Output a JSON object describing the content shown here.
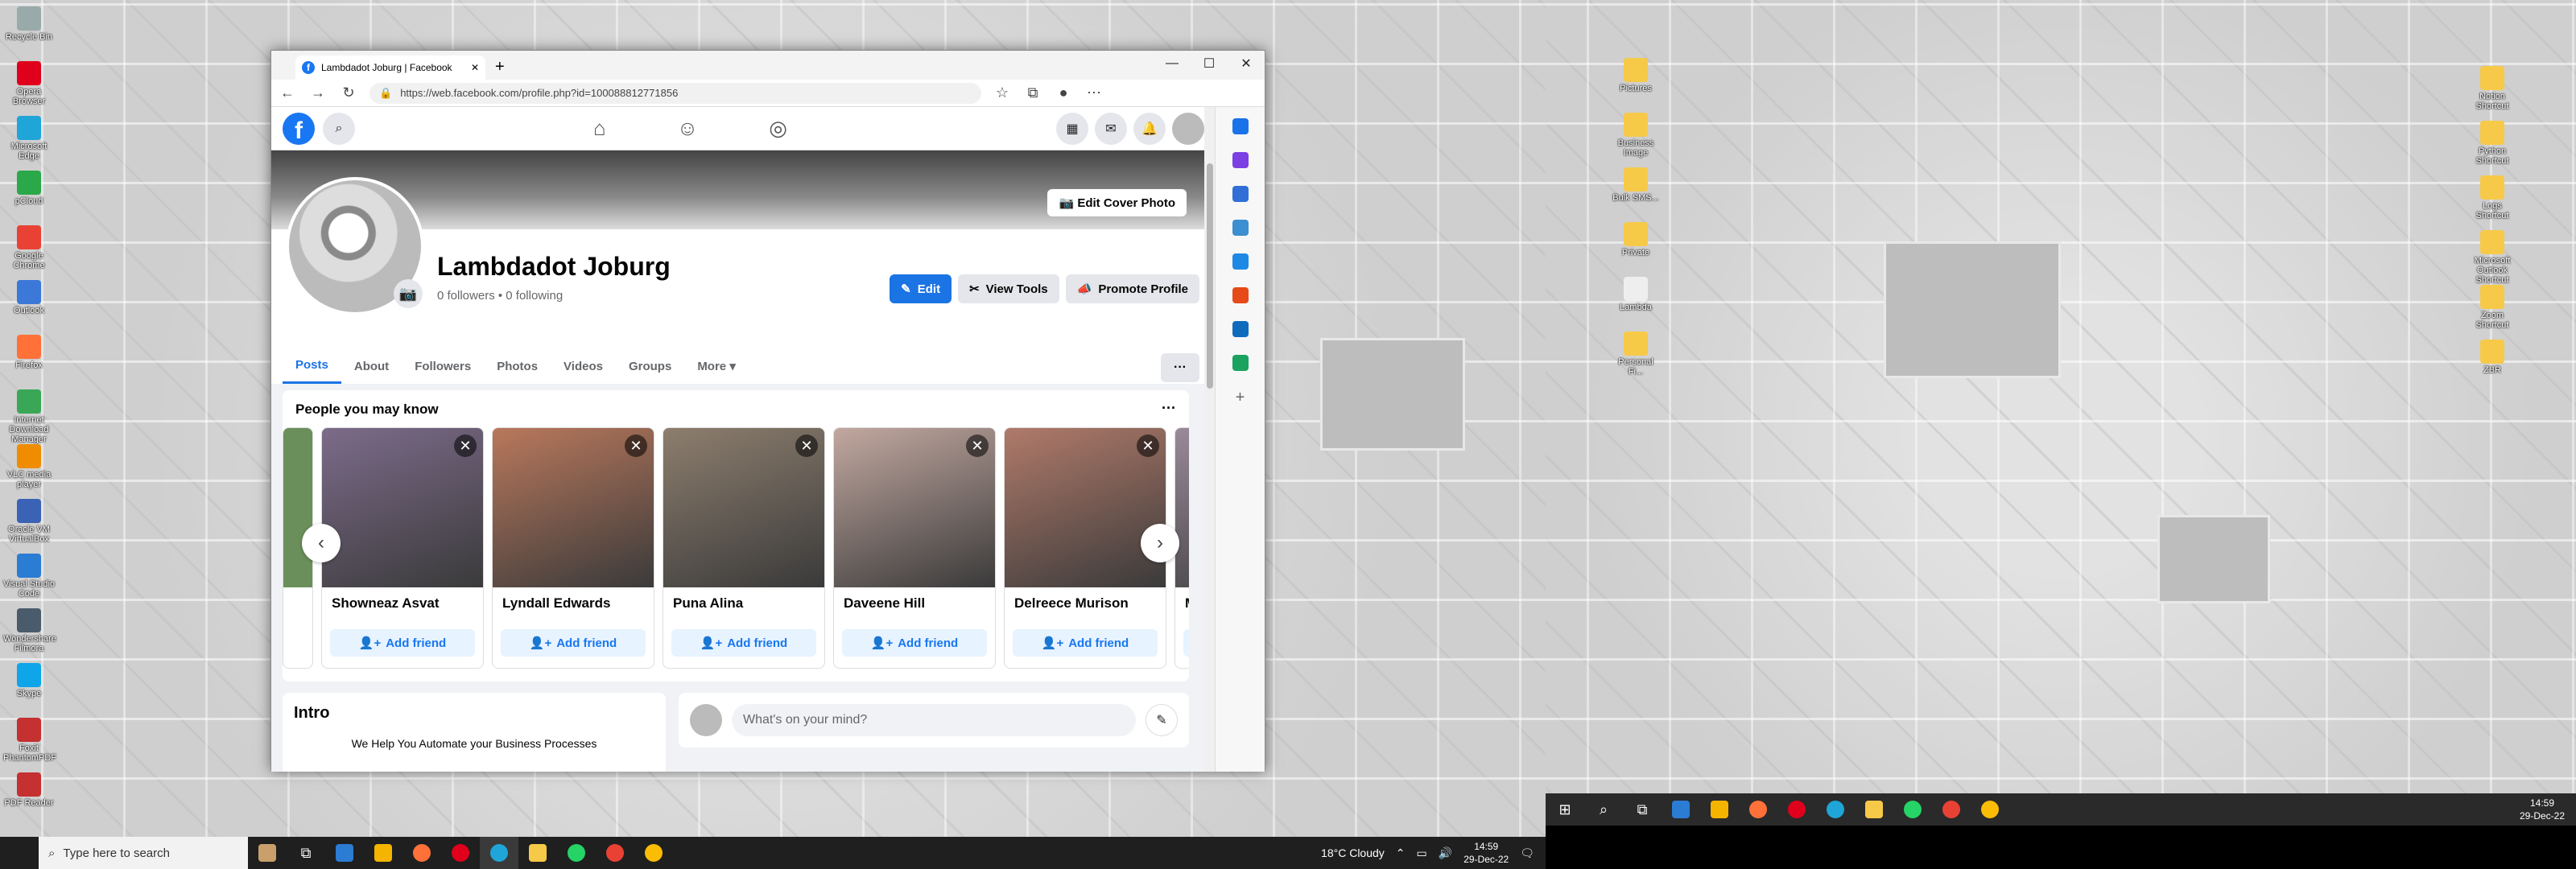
{
  "desktop_left_icons": [
    "Recycle Bin",
    "Opera Browser",
    "Microsoft Edge",
    "pCloud",
    "Google Chrome",
    "Outlook",
    "Firefox",
    "Internet Download Manager",
    "VLC media player",
    "Oracle VM VirtualBox",
    "Visual Studio Code",
    "Wondershare Filmora",
    "Skype",
    "Foxit PhantomPDF",
    "PDF Reader"
  ],
  "desktop_right_icons": [
    "Pictures",
    "Business Image",
    "Bulk SMS...",
    "Private",
    "Lambda",
    "Personal Fi..."
  ],
  "desktop_far_right_icons": [
    "Notion Shortcut",
    "Python Shortcut",
    "Logs Shortcut",
    "Microsoft Outlook Shortcut",
    "Zoom Shortcut",
    "ZBR"
  ],
  "browser": {
    "tab_title": "Lambdadot Joburg | Facebook",
    "url": "https://web.facebook.com/profile.php?id=100088812771856"
  },
  "profile": {
    "name": "Lambdadot Joburg",
    "followers": "0 followers • 0 following",
    "edit_cover": "Edit Cover Photo",
    "btn_edit": "Edit",
    "btn_tools": "View Tools",
    "btn_promote": "Promote Profile",
    "tabs": [
      "Posts",
      "About",
      "Followers",
      "Photos",
      "Videos",
      "Groups",
      "More ▾"
    ]
  },
  "pymk": {
    "title": "People you may know",
    "add_label": "Add friend",
    "people": [
      "Showneaz Asvat",
      "Lyndall Edwards",
      "Puna Alina",
      "Daveene Hill",
      "Delreece Murison",
      "Ma"
    ]
  },
  "intro": {
    "title": "Intro",
    "text": "We Help You Automate your Business Processes"
  },
  "composer": {
    "placeholder": "What's on your mind?"
  },
  "taskbar_left": {
    "search_placeholder": "Type here to search",
    "weather": "18°C  Cloudy",
    "time": "14:59",
    "date": "29-Dec-22"
  },
  "taskbar_right": {
    "time": "14:59",
    "date": "29-Dec-22"
  }
}
